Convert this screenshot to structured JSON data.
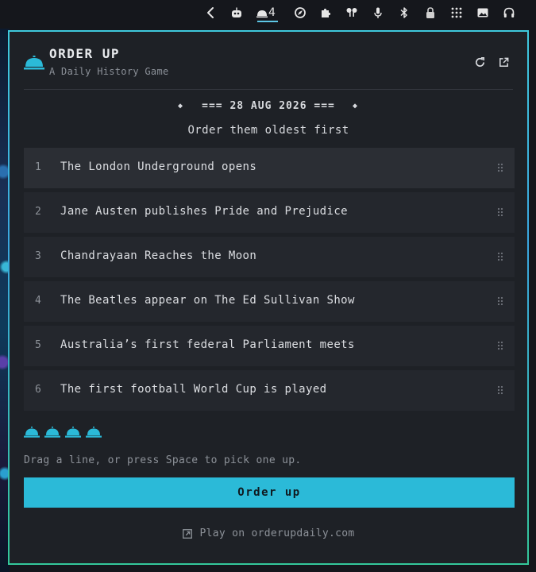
{
  "system_bar": {
    "active_tab_count": "4",
    "icons": [
      "back-arrow-icon",
      "robot-icon",
      "service-bell-icon",
      "safari-compass-icon",
      "puzzle-extension-icon",
      "airpods-icon",
      "microphone-icon",
      "bluetooth-icon",
      "lock-icon",
      "grid-dots-icon",
      "image-icon",
      "headphones-icon"
    ]
  },
  "app": {
    "title": "ORDER UP",
    "subtitle": "A Daily History Game",
    "date_line": "=== 28 AUG 2026 ===",
    "instruction": "Order them oldest first"
  },
  "events": [
    {
      "num": "1",
      "text": "The London Underground opens"
    },
    {
      "num": "2",
      "text": "Jane Austen publishes Pride and Prejudice"
    },
    {
      "num": "3",
      "text": "Chandrayaan Reaches the Moon"
    },
    {
      "num": "4",
      "text": "The Beatles appear on The Ed Sullivan Show"
    },
    {
      "num": "5",
      "text": "Australia’s first federal Parliament meets"
    },
    {
      "num": "6",
      "text": "The first football World Cup is played"
    }
  ],
  "lives_remaining": 4,
  "hint": "Drag a line, or press Space to pick one up.",
  "cta_label": "Order up",
  "footer_link": "Play on orderupdaily.com",
  "colors": {
    "accent": "#2bbad8",
    "panel_bg": "#1e2126",
    "border_gradient": [
      "#3fc9dd",
      "#34c79a"
    ]
  }
}
